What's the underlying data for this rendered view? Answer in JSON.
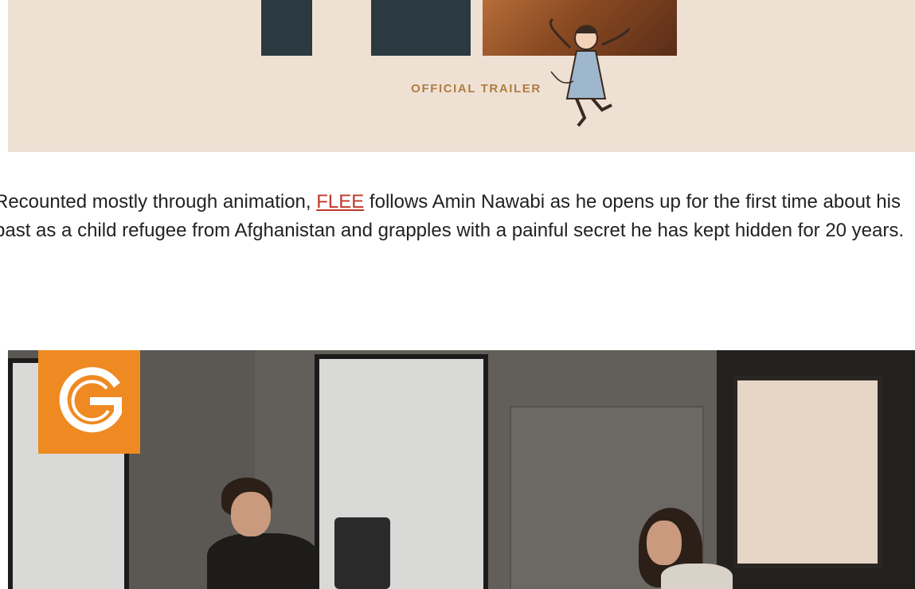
{
  "trailer": {
    "label": "OFFICIAL TRAILER",
    "colors": {
      "background": "#eee1d4",
      "letters": "#2b3a40",
      "label": "#b07c43"
    }
  },
  "description": {
    "before_link": "Recounted mostly through animation, ",
    "link_text": "FLEE",
    "after_link": " follows Amin Nawabi as he opens up for the first time about his past as a child refugee from Afghanistan and grapples with a painful secret he has kept hidden for 20 years.",
    "link_color": "#c0392b"
  },
  "video": {
    "logo_icon": "g-logo-icon",
    "logo_color": "#ef8a22"
  }
}
